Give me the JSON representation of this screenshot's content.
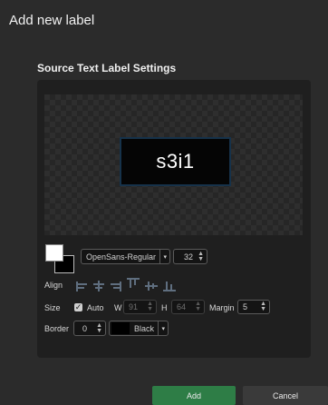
{
  "dialog": {
    "title": "Add new label"
  },
  "section": {
    "title": "Source Text Label Settings"
  },
  "preview": {
    "text": "s3i1"
  },
  "font": {
    "family": "OpenSans-Regular",
    "size": "32"
  },
  "align": {
    "label": "Align"
  },
  "size": {
    "label": "Size",
    "auto_label": "Auto",
    "auto_checked": true,
    "w_label": "W",
    "w_value": "91",
    "h_label": "H",
    "h_value": "64",
    "margin_label": "Margin",
    "margin_value": "5"
  },
  "border": {
    "label": "Border",
    "width_value": "0",
    "color_name": "Black"
  },
  "buttons": {
    "add": "Add",
    "cancel": "Cancel"
  },
  "colors": {
    "primary_button": "#2e7d46",
    "secondary_button": "#3a3a3a",
    "text_color": "#ffffff",
    "background_color": "#000000",
    "accent_border": "#16324a"
  }
}
